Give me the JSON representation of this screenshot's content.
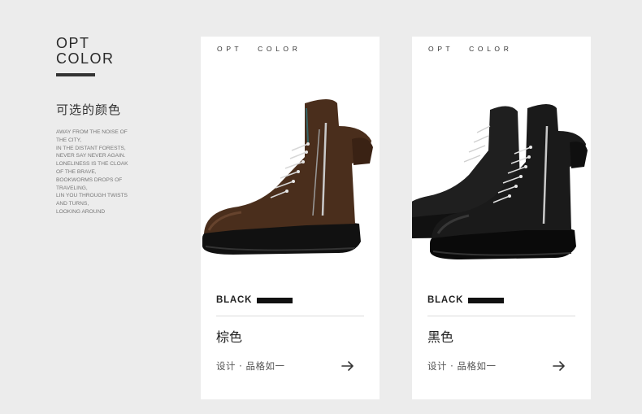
{
  "intro": {
    "title_line1": "OPT",
    "title_line2": "COLOR",
    "cn_heading": "可选的颜色",
    "blurb_lines": [
      "AWAY FROM THE NOISE OF",
      "THE CITY,",
      "IN THE DISTANT FORESTS,",
      "NEVER SAY NEVER AGAIN.",
      "LONELINESS IS THE CLOAK",
      "OF THE BRAVE,",
      "BOOKWORMS DROPS OF",
      "TRAVELING,",
      "LIN YOU THROUGH TWISTS",
      "AND TURNS,",
      "LOOKING AROUND"
    ]
  },
  "cards": [
    {
      "top_label": "O  P  T          C  O  L  O  R",
      "badge": "BLACK",
      "color_name": "棕色",
      "design_text": "设计 · 品格如一",
      "image_icon": "brown-boot",
      "boot_color": "#4a2e1c"
    },
    {
      "top_label": "O  P  T          C  O  L  O  R",
      "badge": "BLACK",
      "color_name": "黑色",
      "design_text": "设计 · 品格如一",
      "image_icon": "black-boot-pair",
      "boot_color": "#1a1a1a"
    }
  ],
  "colors": {
    "background": "#ececec",
    "card": "#ffffff",
    "accent": "#111111"
  }
}
